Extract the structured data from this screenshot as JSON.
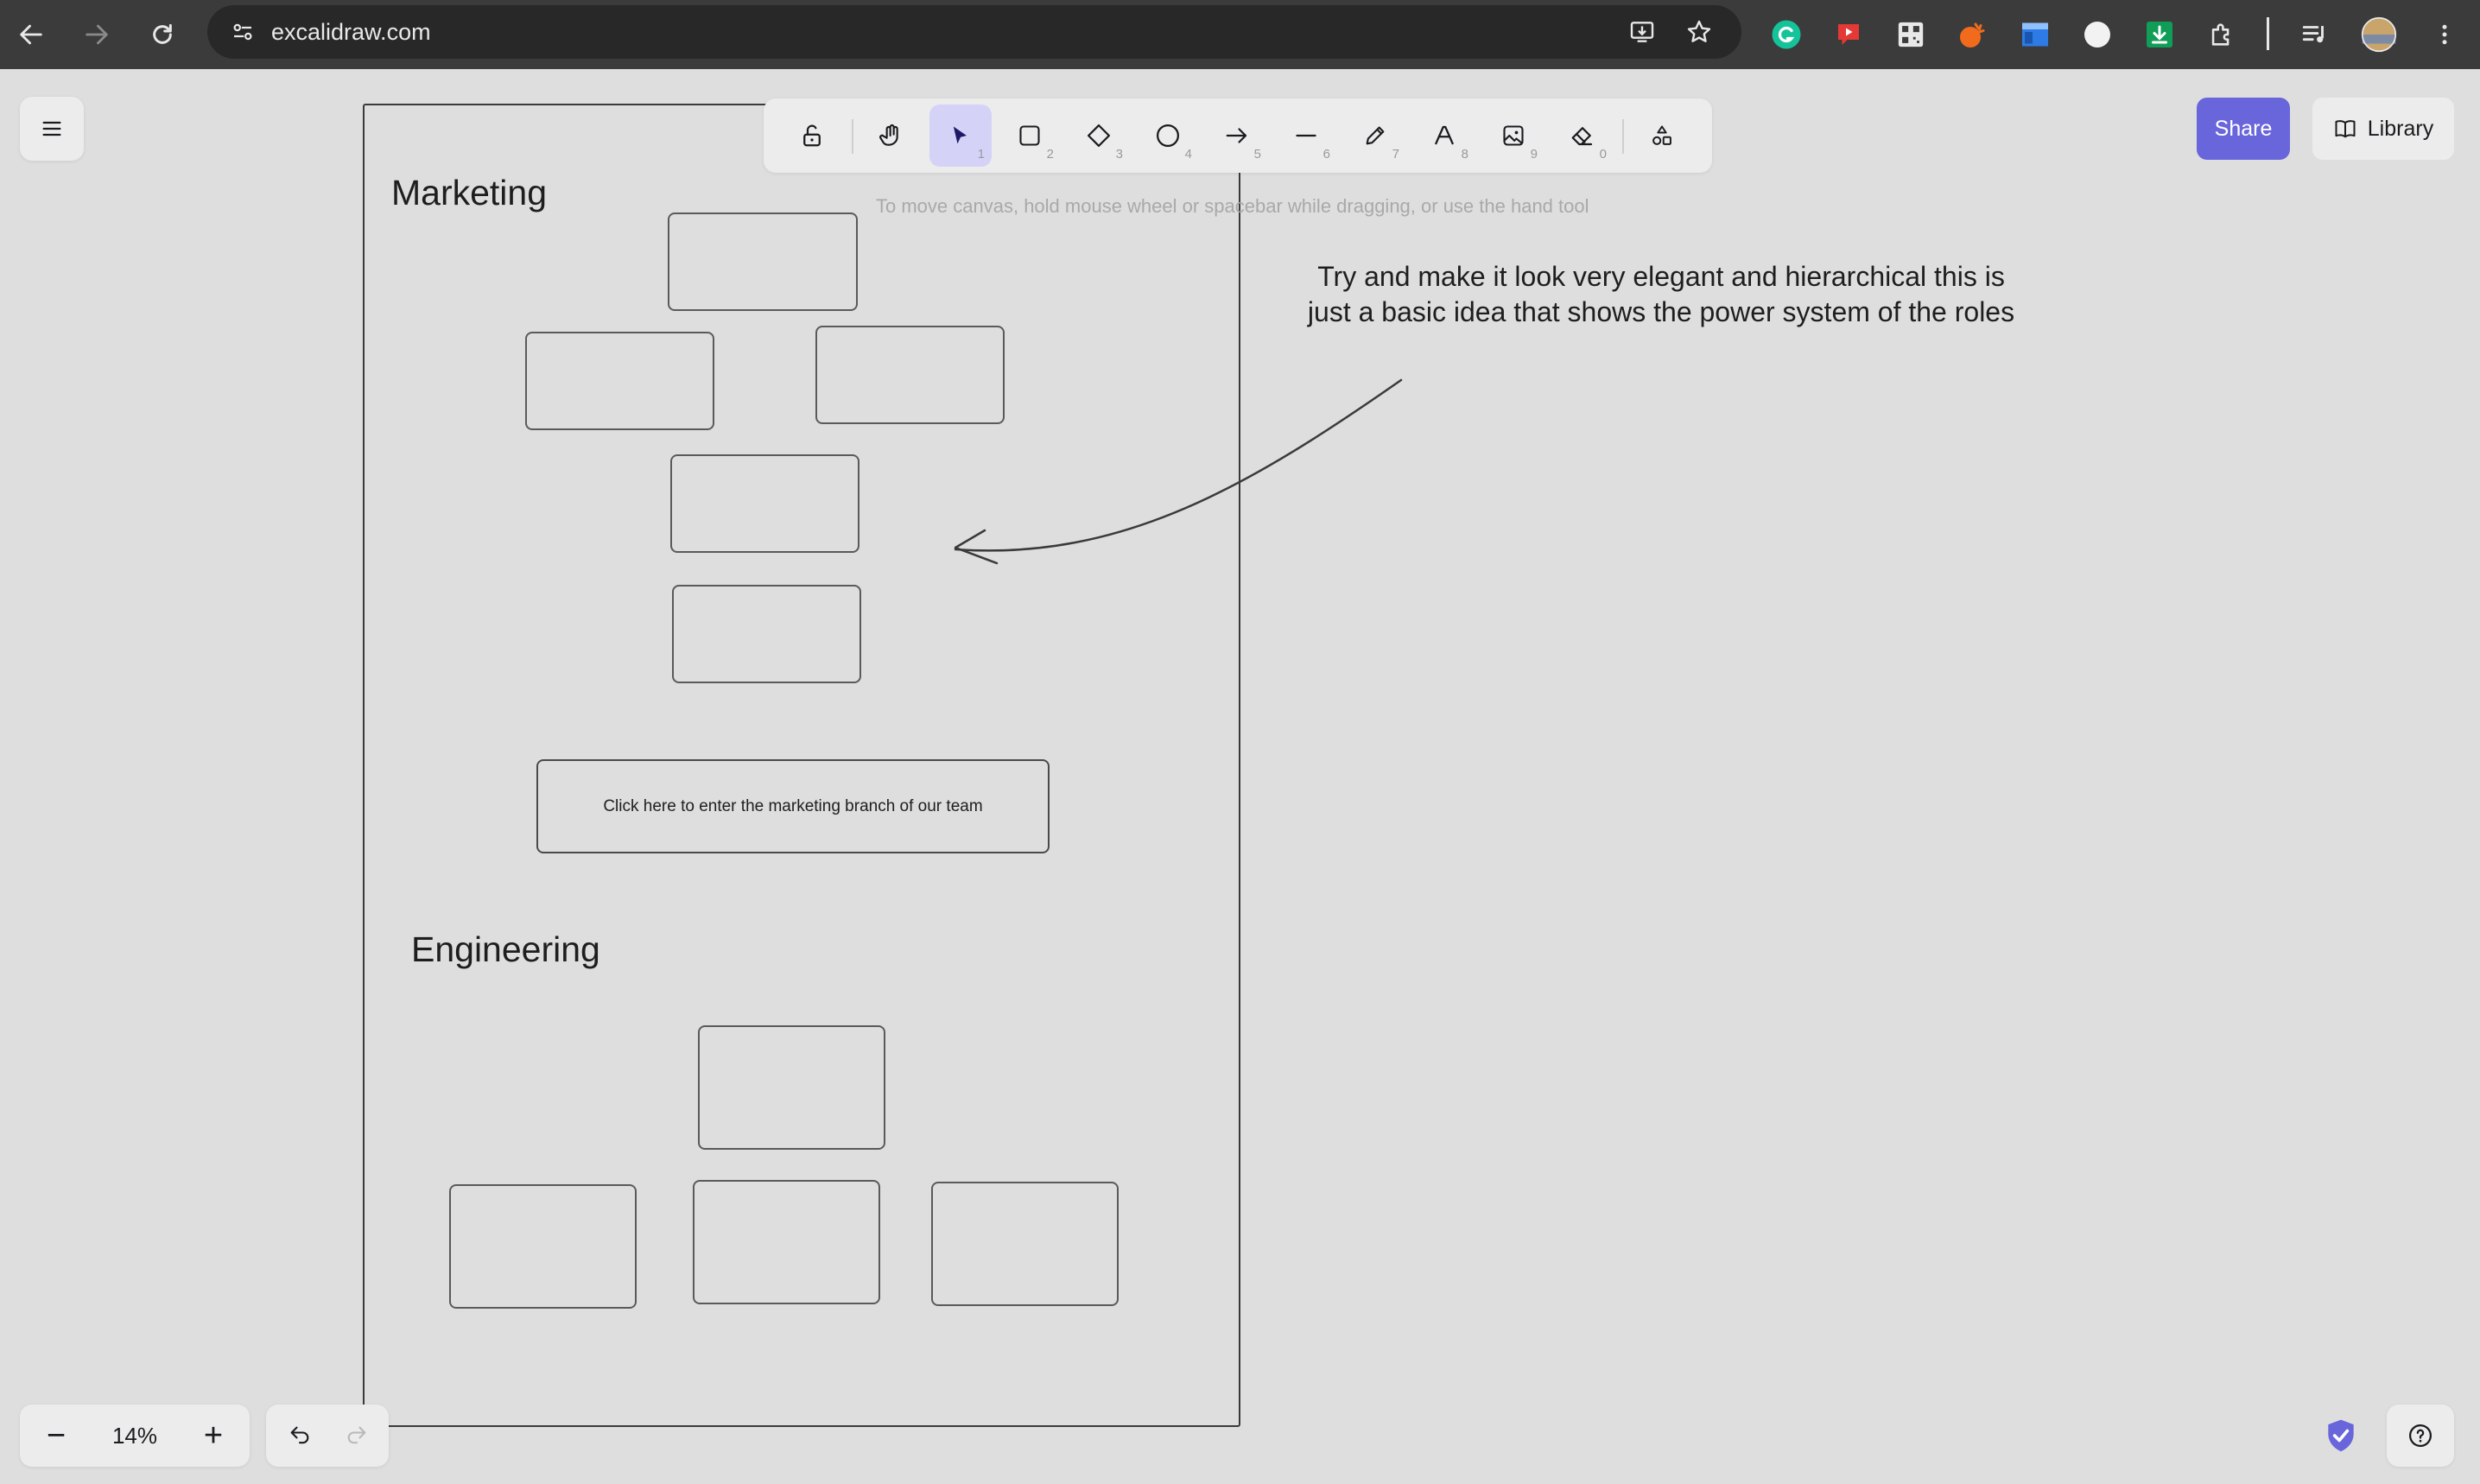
{
  "browser": {
    "url": "excalidraw.com",
    "icons": [
      "back-icon",
      "forward-icon",
      "reload-icon",
      "site-info-icon",
      "install-app-icon",
      "bookmark-star-icon",
      "grammarly-icon",
      "youtube-extension-icon",
      "qr-code-icon",
      "orange-extension-icon",
      "blue-extension-icon",
      "dark-reader-icon",
      "download-extension-icon",
      "extensions-puzzle-icon",
      "media-control-icon",
      "profile-avatar",
      "more-menu-icon"
    ]
  },
  "toolbar": {
    "tools": [
      {
        "name": "lock",
        "key": ""
      },
      {
        "name": "hand",
        "key": ""
      },
      {
        "name": "selection",
        "key": "1",
        "active": true
      },
      {
        "name": "rectangle",
        "key": "2"
      },
      {
        "name": "diamond",
        "key": "3"
      },
      {
        "name": "ellipse",
        "key": "4"
      },
      {
        "name": "arrow",
        "key": "5"
      },
      {
        "name": "line",
        "key": "6"
      },
      {
        "name": "draw",
        "key": "7"
      },
      {
        "name": "text",
        "key": "8"
      },
      {
        "name": "image",
        "key": "9"
      },
      {
        "name": "eraser",
        "key": "0"
      },
      {
        "name": "more-tools",
        "key": ""
      }
    ],
    "accent": "#d4d3f7"
  },
  "header": {
    "share_label": "Share",
    "library_label": "Library",
    "share_color": "#6965db"
  },
  "hint_text": "To move canvas, hold mouse wheel or spacebar while dragging, or use the hand tool",
  "canvas": {
    "marketing_heading": "Marketing",
    "engineering_heading": "Engineering",
    "cta_text": "Click here to enter the marketing branch of our team",
    "note_text": "Try and make it look very elegant and hierarchical this is just a basic idea that shows the power system of the roles"
  },
  "footer": {
    "zoom_level": "14%",
    "zoom_out_label": "−",
    "zoom_in_label": "+"
  }
}
